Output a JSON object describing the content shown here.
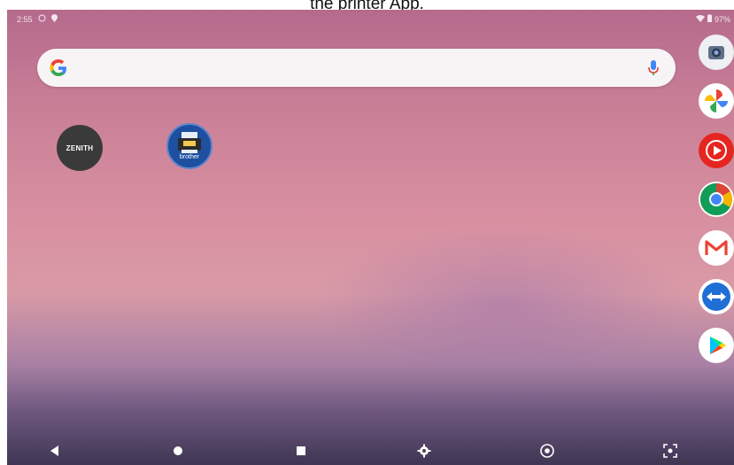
{
  "caption": "the printer App.",
  "status": {
    "time": "2:55",
    "battery": "97%"
  },
  "search": {
    "logo_letter": "G",
    "placeholder": ""
  },
  "home_apps": [
    {
      "label": "ZENITH",
      "icon": "zenith-app-icon"
    },
    {
      "label": "brother",
      "icon": "brother-print-app-icon"
    }
  ],
  "dock": [
    {
      "icon": "camera-app-icon"
    },
    {
      "icon": "photos-app-icon"
    },
    {
      "icon": "youtube-music-app-icon"
    },
    {
      "icon": "chrome-app-icon"
    },
    {
      "icon": "gmail-app-icon"
    },
    {
      "icon": "teamviewer-app-icon"
    },
    {
      "icon": "play-store-app-icon"
    }
  ],
  "navbar": [
    {
      "icon": "back-icon"
    },
    {
      "icon": "home-icon"
    },
    {
      "icon": "recents-icon"
    },
    {
      "icon": "settings-icon"
    },
    {
      "icon": "chrome-nav-icon"
    },
    {
      "icon": "screenshot-icon"
    }
  ],
  "colors": {
    "wallpaper_top": "#b56a8c",
    "wallpaper_mid": "#d88fa0",
    "wallpaper_bottom": "#3e3653",
    "search_bg": "#f7f4f6"
  }
}
